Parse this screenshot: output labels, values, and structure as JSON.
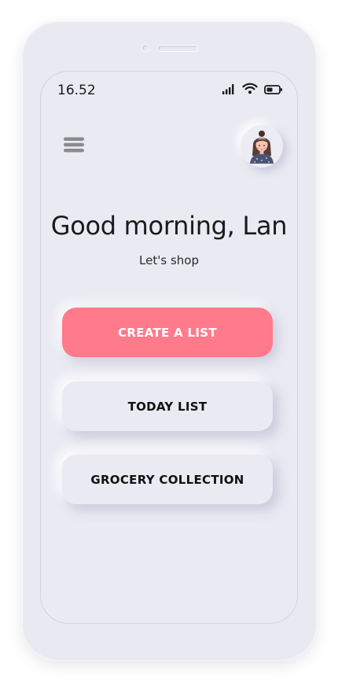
{
  "status_bar": {
    "time": "16.52",
    "icons": [
      "signal-icon",
      "wifi-icon",
      "battery-icon"
    ]
  },
  "header": {
    "menu_icon": "hamburger-menu-icon",
    "avatar_icon": "user-avatar"
  },
  "greeting": {
    "title": "Good morning, Lan",
    "subtitle": "Let's shop"
  },
  "actions": {
    "create_list": "CREATE A LIST",
    "today_list": "TODAY LIST",
    "grocery_collection": "GROCERY COLLECTION"
  },
  "colors": {
    "background": "#e9e9f2",
    "primary": "#ff7a8b",
    "text": "#1a1a1a"
  }
}
